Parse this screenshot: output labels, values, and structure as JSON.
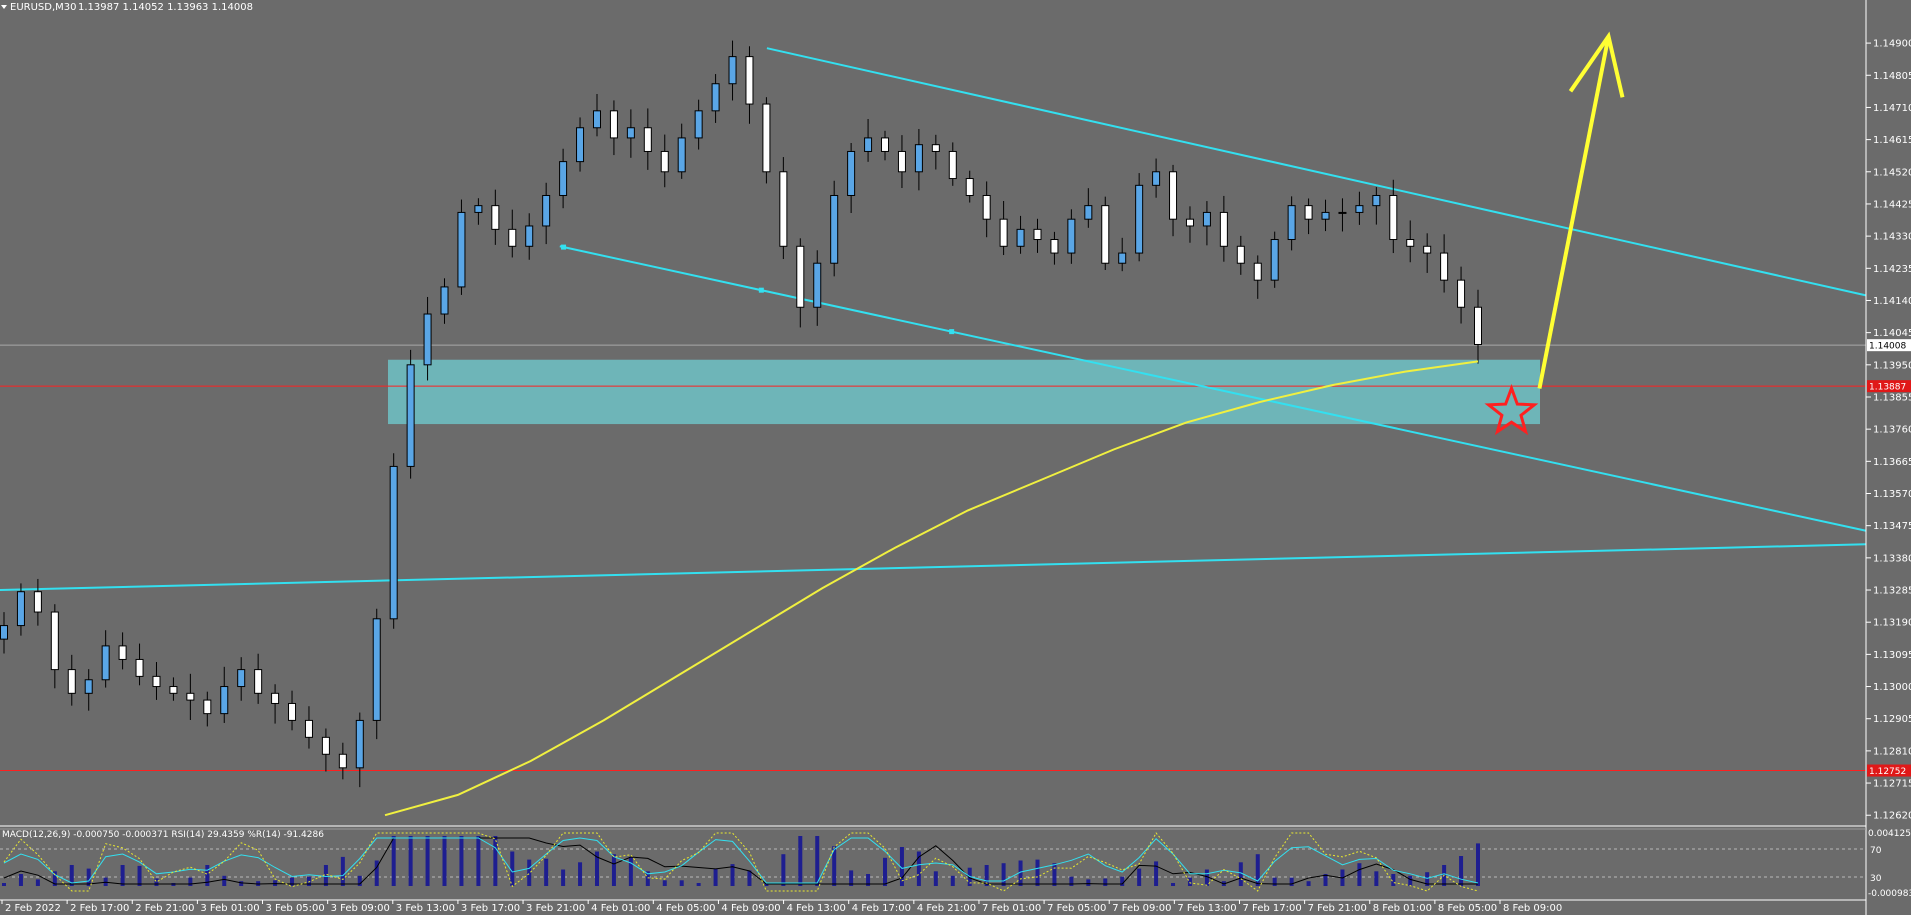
{
  "header": {
    "symbol": "EURUSD,M30",
    "ohlc": "1.13987 1.14052 1.13963 1.14008"
  },
  "colors": {
    "background": "#6b6b6b",
    "candle_bull": "#5aa6e6",
    "candle_bear": "#ffffff",
    "trendline": "#33e0f0",
    "ma": "#f0f040",
    "zone": "#6fd4d8",
    "hline": "#ff2020",
    "arrow": "#ffff33",
    "star": "#ff2020",
    "macd_hist": "#1e1e90"
  },
  "indicator": {
    "label": "MACD(12,26,9) -0.000750 -0.000371 RSI(14) 29.4359 %R(14) -91.4286",
    "levels": [
      {
        "value": "70"
      },
      {
        "value": "30"
      }
    ],
    "right_labels": [
      "0.004125",
      "-0.000983"
    ]
  },
  "chart_data": {
    "type": "candlestick",
    "title": "EURUSD,M30",
    "y_ticks": [
      "1.14900",
      "1.14805",
      "1.14710",
      "1.14615",
      "1.14520",
      "1.14425",
      "1.14330",
      "1.14235",
      "1.14140",
      "1.14045",
      "1.13950",
      "1.13855",
      "1.13760",
      "1.13665",
      "1.13570",
      "1.13475",
      "1.13380",
      "1.13285",
      "1.13190",
      "1.13095",
      "1.13000",
      "1.12905",
      "1.12810",
      "1.12715",
      "1.12620"
    ],
    "x_ticks": [
      "2 Feb 2022",
      "2 Feb 17:00",
      "2 Feb 21:00",
      "3 Feb 01:00",
      "3 Feb 05:00",
      "3 Feb 09:00",
      "3 Feb 13:00",
      "3 Feb 17:00",
      "3 Feb 21:00",
      "4 Feb 01:00",
      "4 Feb 05:00",
      "4 Feb 09:00",
      "4 Feb 13:00",
      "4 Feb 17:00",
      "4 Feb 21:00",
      "7 Feb 01:00",
      "7 Feb 05:00",
      "7 Feb 09:00",
      "7 Feb 13:00",
      "7 Feb 17:00",
      "7 Feb 21:00",
      "8 Feb 01:00",
      "8 Feb 05:00",
      "8 Feb 09:00"
    ],
    "ylim": [
      1.126,
      1.1498
    ],
    "current_price": "1.14008",
    "price_labels": [
      {
        "value": "1.13887",
        "price": 1.13887
      },
      {
        "value": "1.12752",
        "price": 1.12752
      }
    ],
    "zone": {
      "price_low": 1.13775,
      "price_high": 1.13965
    },
    "close_path": [
      1.1318,
      1.1328,
      1.1322,
      1.1305,
      1.1298,
      1.1302,
      1.1312,
      1.1308,
      1.1303,
      1.13,
      1.1298,
      1.1296,
      1.1292,
      1.13,
      1.1305,
      1.1298,
      1.1295,
      1.129,
      1.1285,
      1.128,
      1.1276,
      1.129,
      1.132,
      1.1365,
      1.1395,
      1.141,
      1.1418,
      1.144,
      1.1442,
      1.1435,
      1.143,
      1.1436,
      1.1445,
      1.1455,
      1.1465,
      1.147,
      1.1462,
      1.1465,
      1.1458,
      1.1452,
      1.1462,
      1.147,
      1.1478,
      1.1486,
      1.1472,
      1.1452,
      1.143,
      1.1412,
      1.1425,
      1.1445,
      1.1458,
      1.1462,
      1.1458,
      1.1452,
      1.146,
      1.1458,
      1.145,
      1.1445,
      1.1438,
      1.143,
      1.1435,
      1.1432,
      1.1428,
      1.1438,
      1.1442,
      1.1425,
      1.1428,
      1.1448,
      1.1452,
      1.1438,
      1.1436,
      1.144,
      1.143,
      1.1425,
      1.142,
      1.1432,
      1.1442,
      1.1438,
      1.144,
      1.144,
      1.1442,
      1.1445,
      1.1432,
      1.143,
      1.1428,
      1.142,
      1.1412,
      1.1401
    ],
    "series": [
      {
        "name": "",
        "type": "ma",
        "values": [
          1.1262,
          1.1268,
          1.1278,
          1.129,
          1.1303,
          1.1316,
          1.1329,
          1.1341,
          1.1352,
          1.1361,
          1.137,
          1.1378,
          1.1384,
          1.1389,
          1.1393,
          1.1396
        ]
      }
    ],
    "annotations": [
      {
        "type": "trendline",
        "from": {
          "x": 0.411,
          "y": 1.14885
        },
        "to": {
          "x": 1.0,
          "y": 1.14155
        }
      },
      {
        "type": "trendline",
        "from": {
          "x": 0.3,
          "y": 1.143
        },
        "to": {
          "x": 1.0,
          "y": 1.1346
        }
      },
      {
        "type": "trendline",
        "from": {
          "x": 0.0,
          "y": 1.13285
        },
        "to": {
          "x": 1.0,
          "y": 1.1342
        }
      },
      {
        "type": "hline",
        "price": 1.13887
      },
      {
        "type": "hline",
        "price": 1.12752
      },
      {
        "type": "hline",
        "price": 1.14008
      },
      {
        "type": "arrow",
        "from": {
          "x": 0.825,
          "y": 1.1388
        },
        "to": {
          "x": 0.862,
          "y": 1.1492
        }
      },
      {
        "type": "star",
        "at": {
          "x": 0.81,
          "y": 1.1381
        }
      }
    ]
  }
}
